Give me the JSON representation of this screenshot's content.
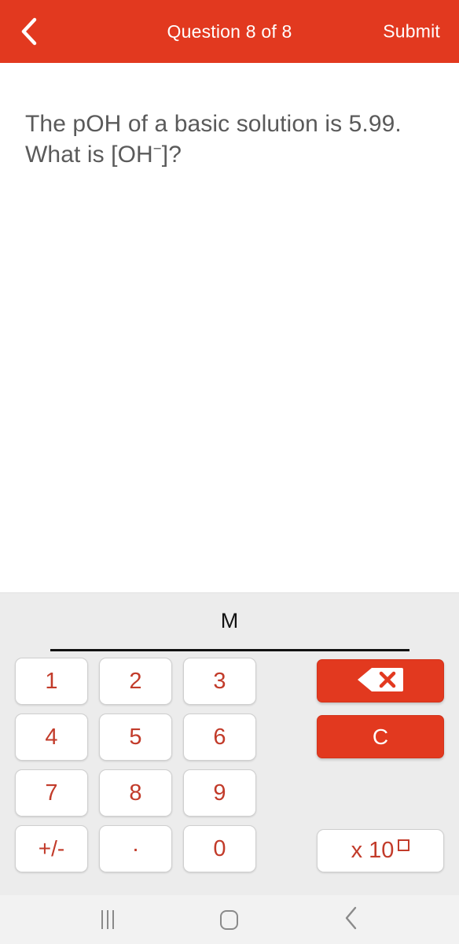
{
  "header": {
    "back_icon": "chevron-left-icon",
    "title": "Question 8 of 8",
    "submit_label": "Submit",
    "background_color": "#e2391f",
    "text_color": "#ffffff"
  },
  "question": {
    "line1": "The pOH of a basic solution is",
    "line2_prefix": "5.99. What is [OH",
    "line2_superscript": "−",
    "line2_suffix": "]?",
    "full_text": "The pOH of a basic solution is 5.99. What is [OH⁻]?",
    "text_color": "#5a5a5a"
  },
  "calculator": {
    "background_color": "#ececec",
    "answer_value": "",
    "answer_placeholder": "",
    "unit_label": "M",
    "number_keys": [
      "1",
      "2",
      "3",
      "4",
      "5",
      "6",
      "7",
      "8",
      "9",
      "+/-",
      ".",
      "0"
    ],
    "key_text_color": "#c23b2a",
    "key_background": "#ffffff",
    "backspace_icon": "backspace-icon",
    "clear_label": "C",
    "exponent_label": "x 10",
    "exponent_placeholder_icon": "empty-square-icon",
    "action_key_color": "#e2391f"
  },
  "navbar": {
    "recents_icon": "recents-icon",
    "home_icon": "home-icon",
    "back_icon": "back-icon",
    "background_color": "#f2f2f2",
    "icon_color": "#8a8a8a"
  }
}
